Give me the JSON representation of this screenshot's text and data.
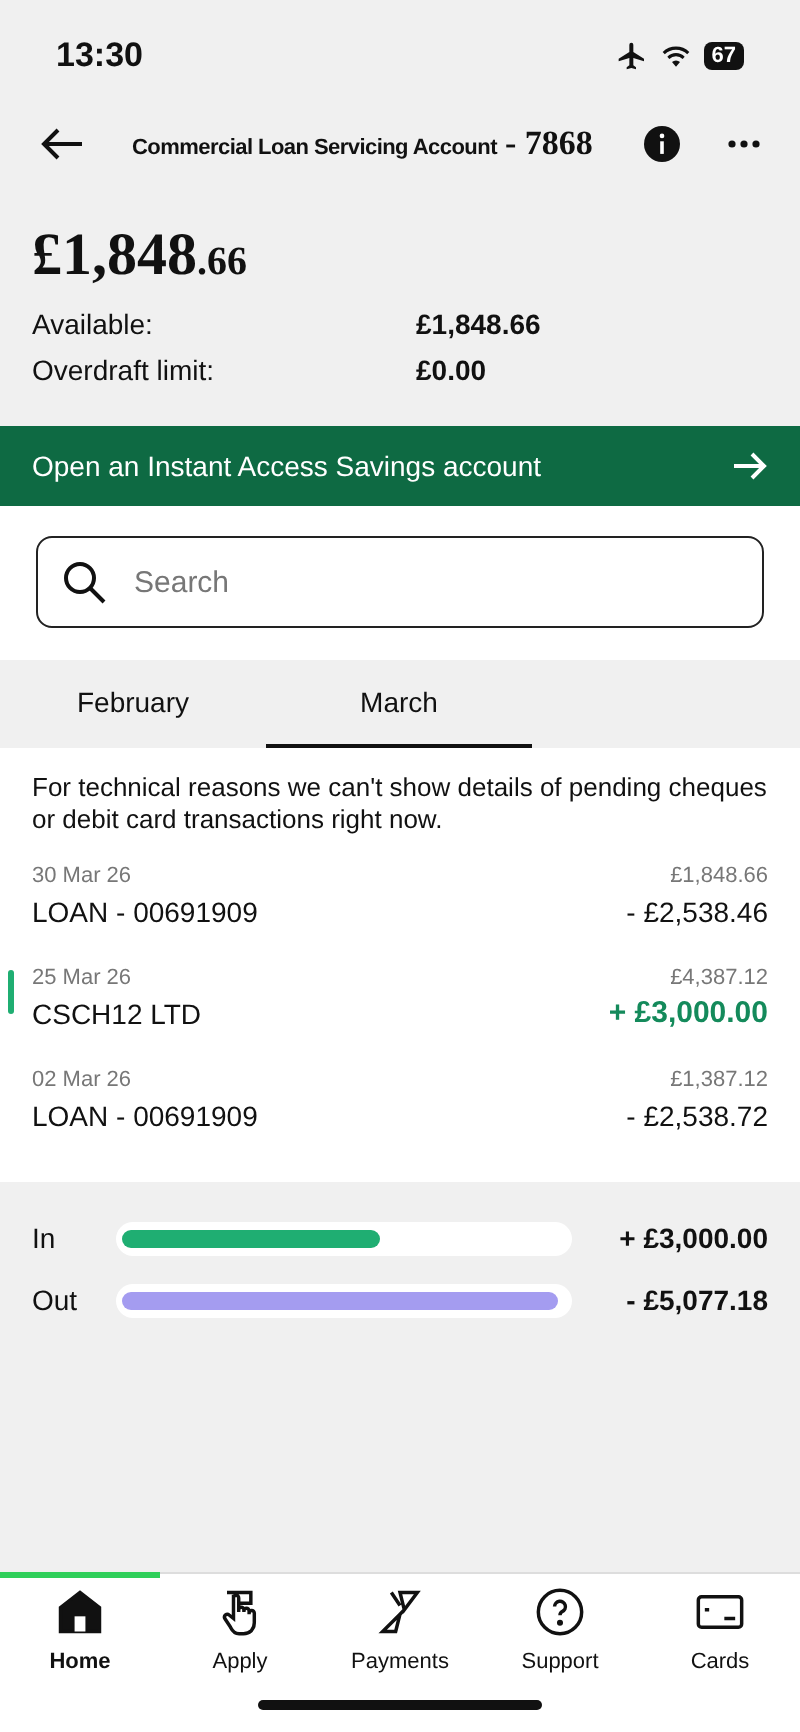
{
  "status_bar": {
    "time": "13:30",
    "battery": "67"
  },
  "header": {
    "title": "Commercial Loan Servicing Account",
    "number": "- 7868"
  },
  "balance": {
    "whole": "£1,848",
    "pence": ".66",
    "rows": [
      {
        "label": "Available:",
        "value": "£1,848.66"
      },
      {
        "label": "Overdraft limit:",
        "value": "£0.00"
      }
    ]
  },
  "banner": {
    "text": "Open an Instant Access Savings account"
  },
  "search": {
    "placeholder": "Search"
  },
  "tabs": [
    {
      "label": "February",
      "selected": false
    },
    {
      "label": "March",
      "selected": true
    }
  ],
  "notice": "For technical reasons we can't show details of pending cheques or debit card transactions right now.",
  "transactions": [
    {
      "date": "30 Mar 26",
      "name": "LOAN - 00691909",
      "balance": "£1,848.66",
      "amount": "- £2,538.46",
      "kind": "debit",
      "highlighted": false
    },
    {
      "date": "25 Mar 26",
      "name": "CSCH12 LTD",
      "balance": "£4,387.12",
      "amount": "+ £3,000.00",
      "kind": "credit",
      "highlighted": true
    },
    {
      "date": "02 Mar 26",
      "name": "LOAN - 00691909",
      "balance": "£1,387.12",
      "amount": "- £2,538.72",
      "kind": "debit",
      "highlighted": false
    }
  ],
  "summary": [
    {
      "label": "In",
      "level": 0.58,
      "color": "#1fae72",
      "amount": "+ £3,000.00"
    },
    {
      "label": "Out",
      "level": 0.98,
      "color": "#a49cf0",
      "amount": "- £5,077.18"
    }
  ],
  "nav": [
    {
      "label": "Home",
      "kind": "home",
      "selected": true
    },
    {
      "label": "Apply",
      "kind": "apply",
      "selected": false
    },
    {
      "label": "Payments",
      "kind": "payments",
      "selected": false
    },
    {
      "label": "Support",
      "kind": "support",
      "selected": false
    },
    {
      "label": "Cards",
      "kind": "cards",
      "selected": false
    }
  ]
}
